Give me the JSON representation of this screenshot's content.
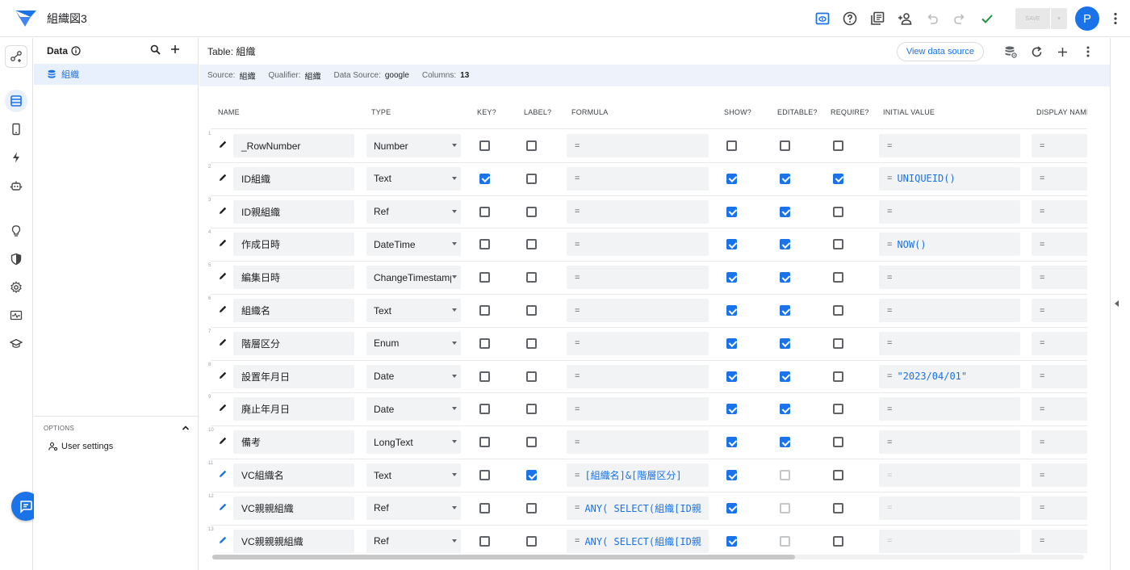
{
  "app": {
    "title": "組織図3"
  },
  "toolbar": {
    "save_label": "SAVE",
    "avatar_letter": "P"
  },
  "data_panel": {
    "header": "Data",
    "tables": [
      {
        "label": "組織"
      }
    ],
    "options_title": "OPTIONS",
    "options_items": [
      {
        "label": "User settings"
      }
    ]
  },
  "main": {
    "table_title": "Table: 組織",
    "view_data_source_label": "View data source",
    "info": {
      "source_label": "Source:",
      "source_value": "組織",
      "qualifier_label": "Qualifier:",
      "qualifier_value": "組織",
      "datasource_label": "Data Source:",
      "datasource_value": "google",
      "columns_label": "Columns:",
      "columns_value": "13"
    },
    "headers": {
      "name": "NAME",
      "type": "TYPE",
      "key": "KEY?",
      "label": "LABEL?",
      "formula": "FORMULA",
      "show": "SHOW?",
      "editable": "EDITABLE?",
      "require": "REQUIRE?",
      "initial": "INITIAL VALUE",
      "display": "DISPLAY NAME"
    },
    "rows": [
      {
        "num": "1",
        "name": "_RowNumber",
        "type": "Number",
        "key": false,
        "label": false,
        "formula_prefix": "=",
        "formula": "",
        "show": false,
        "editable": false,
        "editable_disabled": false,
        "require": false,
        "initial_prefix": "=",
        "initial": "",
        "initial_dim": false,
        "display": "=",
        "pen_color": "#202124"
      },
      {
        "num": "2",
        "name": "ID組織",
        "type": "Text",
        "key": true,
        "label": false,
        "formula_prefix": "=",
        "formula": "",
        "show": true,
        "editable": true,
        "editable_disabled": false,
        "require": true,
        "initial_prefix": "=",
        "initial": "UNIQUEID()",
        "initial_dim": false,
        "display": "=",
        "pen_color": "#202124"
      },
      {
        "num": "3",
        "name": "ID親組織",
        "type": "Ref",
        "key": false,
        "label": false,
        "formula_prefix": "=",
        "formula": "",
        "show": true,
        "editable": true,
        "editable_disabled": false,
        "require": false,
        "initial_prefix": "=",
        "initial": "",
        "initial_dim": false,
        "display": "=",
        "pen_color": "#202124"
      },
      {
        "num": "4",
        "name": "作成日時",
        "type": "DateTime",
        "key": false,
        "label": false,
        "formula_prefix": "=",
        "formula": "",
        "show": true,
        "editable": true,
        "editable_disabled": false,
        "require": false,
        "initial_prefix": "=",
        "initial": "NOW()",
        "initial_dim": false,
        "display": "=",
        "pen_color": "#202124"
      },
      {
        "num": "5",
        "name": "編集日時",
        "type": "ChangeTimestamp",
        "key": false,
        "label": false,
        "formula_prefix": "=",
        "formula": "",
        "show": true,
        "editable": true,
        "editable_disabled": false,
        "require": false,
        "initial_prefix": "=",
        "initial": "",
        "initial_dim": false,
        "display": "=",
        "pen_color": "#202124"
      },
      {
        "num": "6",
        "name": "組織名",
        "type": "Text",
        "key": false,
        "label": false,
        "formula_prefix": "=",
        "formula": "",
        "show": true,
        "editable": true,
        "editable_disabled": false,
        "require": false,
        "initial_prefix": "=",
        "initial": "",
        "initial_dim": false,
        "display": "=",
        "pen_color": "#202124"
      },
      {
        "num": "7",
        "name": "階層区分",
        "type": "Enum",
        "key": false,
        "label": false,
        "formula_prefix": "=",
        "formula": "",
        "show": true,
        "editable": true,
        "editable_disabled": false,
        "require": false,
        "initial_prefix": "=",
        "initial": "",
        "initial_dim": false,
        "display": "=",
        "pen_color": "#202124"
      },
      {
        "num": "8",
        "name": "設置年月日",
        "type": "Date",
        "key": false,
        "label": false,
        "formula_prefix": "=",
        "formula": "",
        "show": true,
        "editable": true,
        "editable_disabled": false,
        "require": false,
        "initial_prefix": "=",
        "initial": "\"2023/04/01\"",
        "initial_dim": false,
        "display": "=",
        "pen_color": "#202124"
      },
      {
        "num": "9",
        "name": "廃止年月日",
        "type": "Date",
        "key": false,
        "label": false,
        "formula_prefix": "=",
        "formula": "",
        "show": true,
        "editable": true,
        "editable_disabled": false,
        "require": false,
        "initial_prefix": "=",
        "initial": "",
        "initial_dim": false,
        "display": "=",
        "pen_color": "#202124"
      },
      {
        "num": "10",
        "name": "備考",
        "type": "LongText",
        "key": false,
        "label": false,
        "formula_prefix": "=",
        "formula": "",
        "show": true,
        "editable": true,
        "editable_disabled": false,
        "require": false,
        "initial_prefix": "=",
        "initial": "",
        "initial_dim": false,
        "display": "=",
        "pen_color": "#202124"
      },
      {
        "num": "11",
        "name": "VC組織名",
        "type": "Text",
        "key": false,
        "label": true,
        "formula_prefix": "=",
        "formula": "[組織名]&[階層区分]",
        "show": true,
        "editable": false,
        "editable_disabled": true,
        "require": false,
        "initial_prefix": "=",
        "initial": "",
        "initial_dim": true,
        "display": "=",
        "pen_color": "#1a73e8"
      },
      {
        "num": "12",
        "name": "VC親親組織",
        "type": "Ref",
        "key": false,
        "label": false,
        "formula_prefix": "=",
        "formula": "ANY(  SELECT(組織[ID親",
        "show": true,
        "editable": false,
        "editable_disabled": true,
        "require": false,
        "initial_prefix": "=",
        "initial": "",
        "initial_dim": true,
        "display": "=",
        "pen_color": "#1a73e8"
      },
      {
        "num": "13",
        "name": "VC親親親組織",
        "type": "Ref",
        "key": false,
        "label": false,
        "formula_prefix": "=",
        "formula": "ANY(  SELECT(組織[ID親",
        "show": true,
        "editable": false,
        "editable_disabled": true,
        "require": false,
        "initial_prefix": "=",
        "initial": "",
        "initial_dim": true,
        "display": "=",
        "pen_color": "#1a73e8"
      }
    ]
  },
  "colors": {
    "accent": "#1a73e8",
    "selected_bg": "#e8f0fe",
    "infobar_bg": "#eef3fb"
  }
}
